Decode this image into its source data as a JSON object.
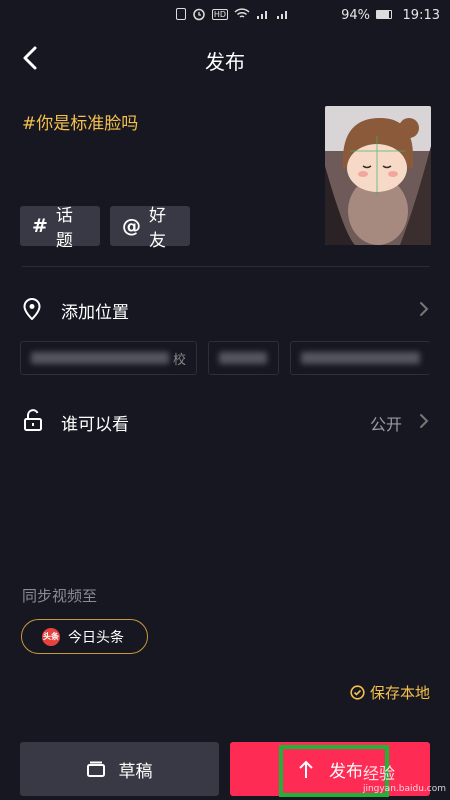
{
  "status_bar": {
    "battery": "94%",
    "time": "19:13",
    "icons": [
      "vibrate-icon",
      "alarm-icon",
      "hd-icon",
      "wifi-icon",
      "signal-4g-icon",
      "signal-3g-icon",
      "battery-icon"
    ]
  },
  "header": {
    "title": "发布"
  },
  "post": {
    "caption": "#你是标准脸吗",
    "chips": [
      {
        "symbol": "#",
        "label": "话题"
      },
      {
        "symbol": "@",
        "label": "好友"
      }
    ]
  },
  "location": {
    "label": "添加位置",
    "suggestions": [
      "校",
      "",
      ""
    ]
  },
  "visibility": {
    "label": "谁可以看",
    "value": "公开"
  },
  "sync": {
    "label": "同步视频至",
    "target": "今日头条",
    "target_logo": "头条"
  },
  "save_local": {
    "label": "保存本地"
  },
  "actions": {
    "draft": "草稿",
    "publish": "发布"
  },
  "watermark": {
    "brand": "经验",
    "url": "jingyan.baidu.com"
  },
  "colors": {
    "accent_yellow": "#f5c14a",
    "publish_red": "#fe2c55",
    "background": "#171722"
  }
}
